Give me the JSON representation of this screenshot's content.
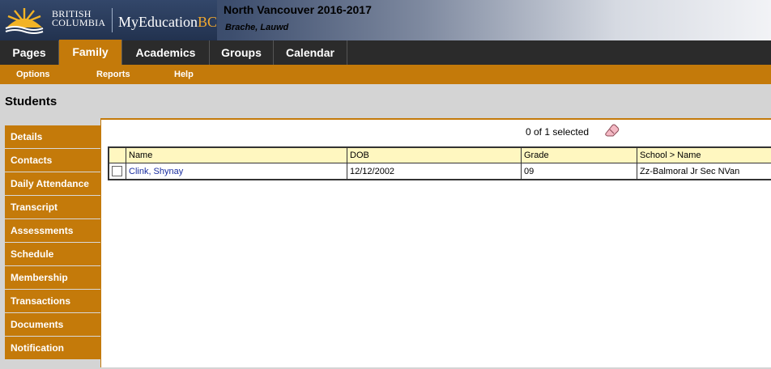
{
  "header": {
    "bc_line1": "BRITISH",
    "bc_line2": "COLUMBIA",
    "app_name_main": "MyEducation",
    "app_name_bc": "BC",
    "school_year": "North Vancouver 2016-2017",
    "user_name": "Brache, Lauwd"
  },
  "topnav": {
    "tabs": [
      {
        "label": "Pages"
      },
      {
        "label": "Family"
      },
      {
        "label": "Academics"
      },
      {
        "label": "Groups"
      },
      {
        "label": "Calendar"
      }
    ],
    "active": "Family"
  },
  "subnav": {
    "items": [
      {
        "label": "Options"
      },
      {
        "label": "Reports"
      },
      {
        "label": "Help"
      }
    ]
  },
  "page_title": "Students",
  "sidemenu": {
    "items": [
      {
        "label": "Details"
      },
      {
        "label": "Contacts"
      },
      {
        "label": "Daily Attendance"
      },
      {
        "label": "Transcript"
      },
      {
        "label": "Assessments"
      },
      {
        "label": "Schedule"
      },
      {
        "label": "Membership"
      },
      {
        "label": "Transactions"
      },
      {
        "label": "Documents"
      },
      {
        "label": "Notification"
      }
    ]
  },
  "grid": {
    "selection_text": "0 of 1 selected",
    "columns": [
      "Name",
      "DOB",
      "Grade",
      "School > Name"
    ],
    "rows": [
      {
        "name": "Clink, Shynay",
        "dob": "12/12/2002",
        "grade": "09",
        "school": "Zz-Balmoral Jr Sec NVan"
      }
    ]
  },
  "colors": {
    "accent_orange": "#c47a0a",
    "nav_dark": "#2b2b2b",
    "header_blue": "#22324f",
    "grid_header": "#fff7c0",
    "link": "#1a2ea0"
  },
  "icons": {
    "logo": "bc-sunrise-logo",
    "selection_clear": "eraser-icon"
  }
}
